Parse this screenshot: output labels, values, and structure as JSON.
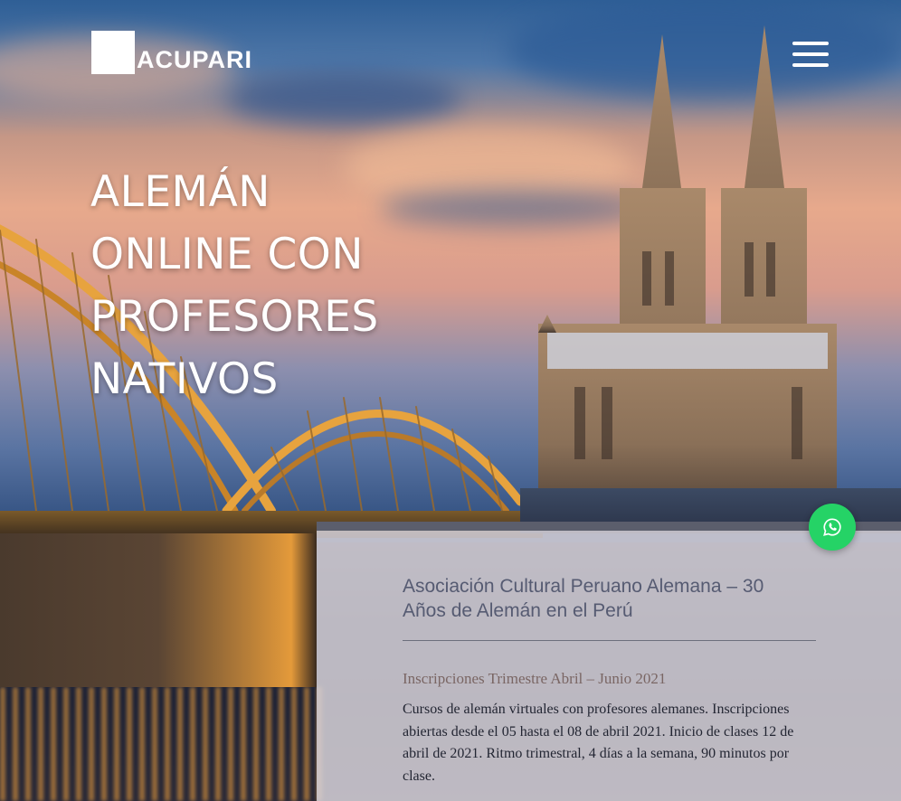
{
  "brand": {
    "name": "ACUPARI"
  },
  "header": {
    "menu_icon": "hamburger-menu-icon"
  },
  "hero": {
    "headline": "ALEMÁN ONLINE CON PROFESORES NATIVOS"
  },
  "card": {
    "title": "Asociación Cultural Peruano Alemana – 30 Años de Alemán en el Perú",
    "subtitle": "Inscripciones Trimestre Abril – Junio 2021",
    "body": "Cursos de alemán virtuales con profesores alemanes. Inscripciones abiertas desde el 05 hasta el 08 de abril 2021. Inicio de clases 12 de abril de 2021. Ritmo trimestral, 4 días a la semana, 90 minutos por clase."
  },
  "floating": {
    "icon": "whatsapp-icon",
    "color": "#25d366"
  },
  "colors": {
    "title": "#565b72",
    "subtitle": "#7a6664",
    "body": "#232633",
    "card_bg": "#d6d2d8"
  }
}
